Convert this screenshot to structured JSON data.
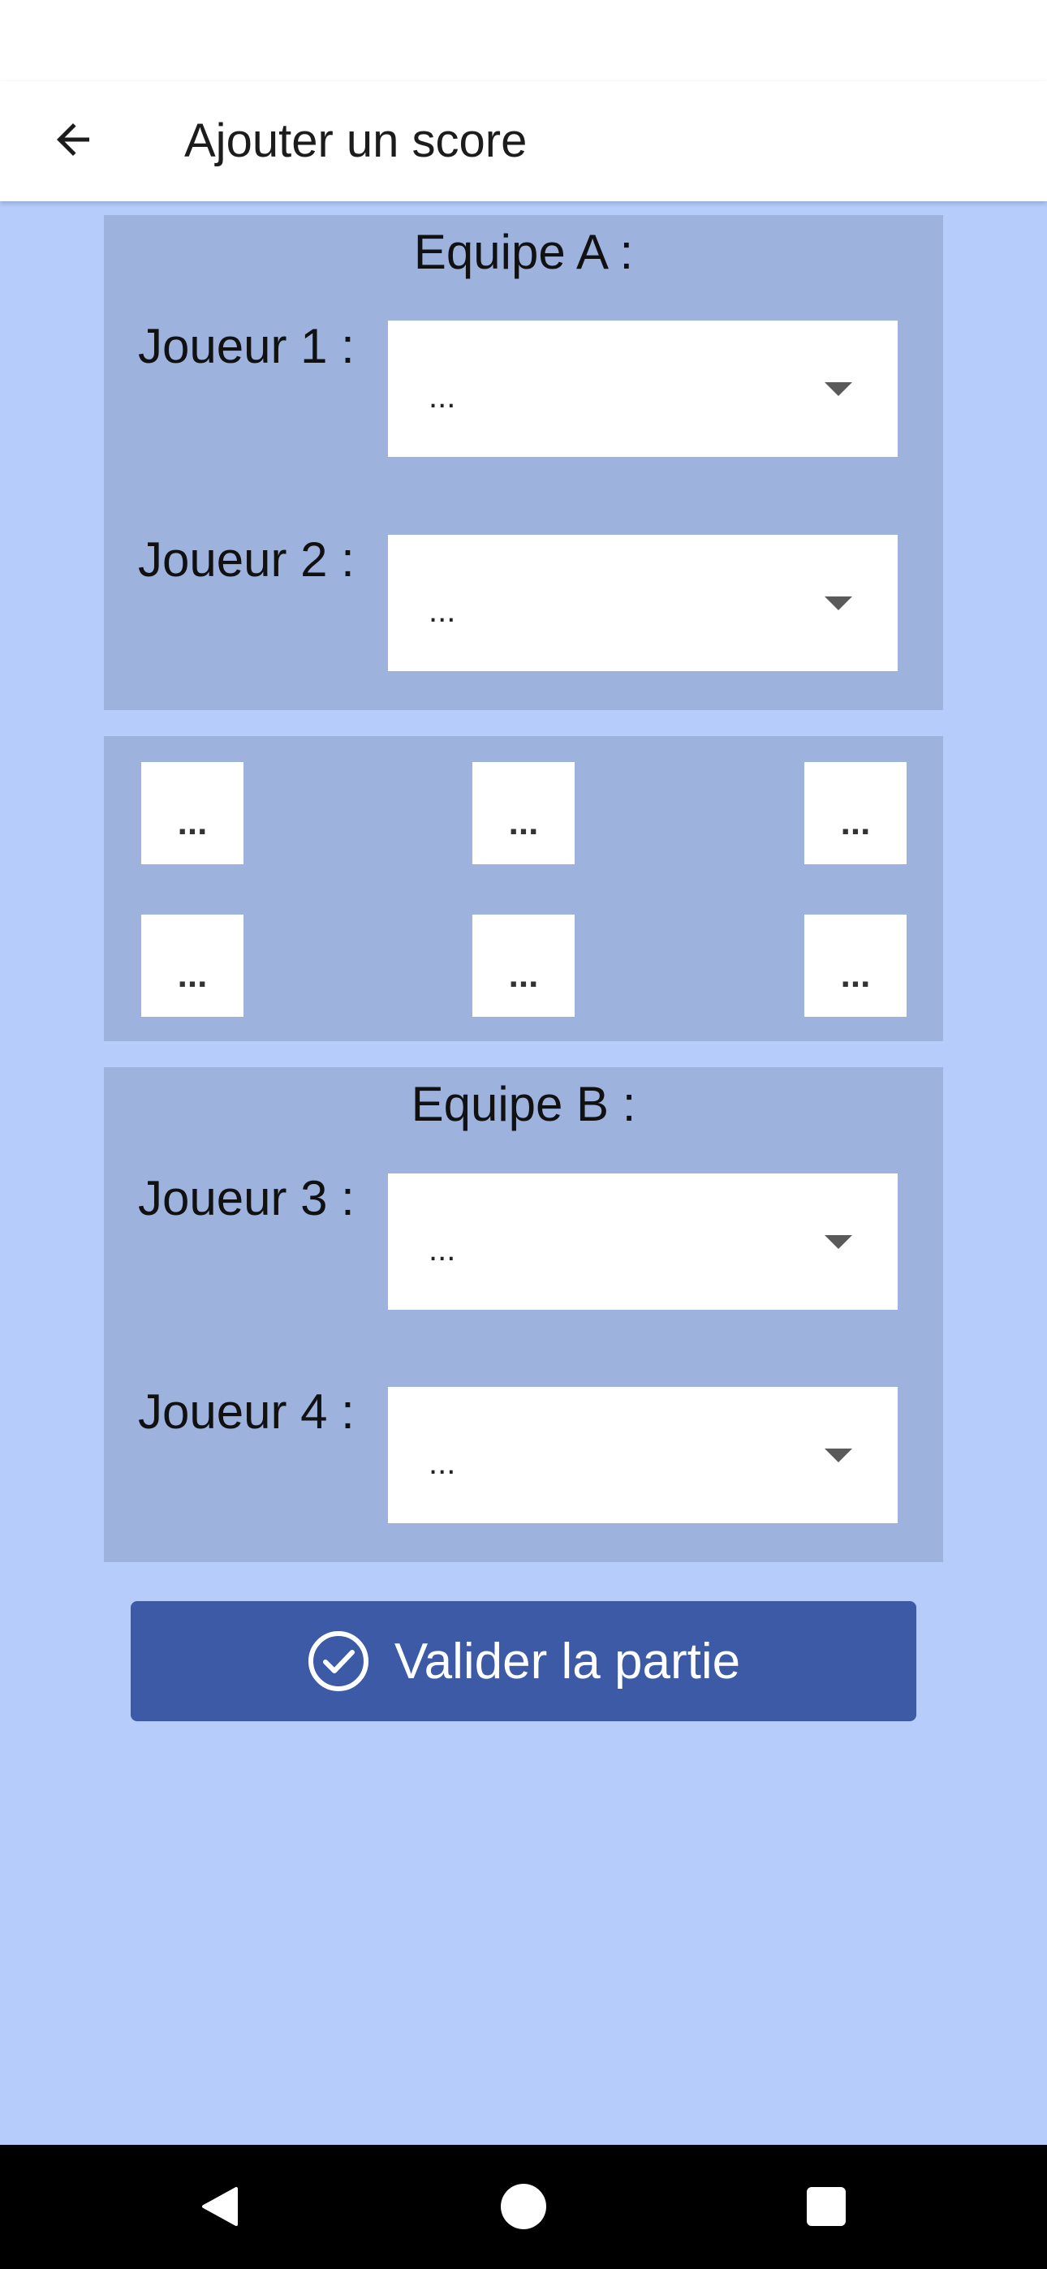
{
  "app_bar": {
    "title": "Ajouter un score",
    "back_icon": "arrow-left-icon"
  },
  "team_a": {
    "title": "Equipe A :",
    "players": [
      {
        "label": "Joueur 1 :",
        "value": "..."
      },
      {
        "label": "Joueur 2 :",
        "value": "..."
      }
    ]
  },
  "scores": {
    "row1": [
      "...",
      "...",
      "..."
    ],
    "row2": [
      "...",
      "...",
      "..."
    ]
  },
  "team_b": {
    "title": "Equipe B :",
    "players": [
      {
        "label": "Joueur 3 :",
        "value": "..."
      },
      {
        "label": "Joueur 4 :",
        "value": "..."
      }
    ]
  },
  "validate_button": {
    "label": "Valider la partie",
    "icon": "check-circle-icon"
  },
  "nav_bar": {
    "icons": [
      "back-triangle-icon",
      "home-circle-icon",
      "recents-square-icon"
    ]
  },
  "colors": {
    "background": "#b6cdfc",
    "panel": "#9db3de",
    "button": "#3c5aa5",
    "app_bar": "#ffffff",
    "nav_bar": "#000000"
  }
}
